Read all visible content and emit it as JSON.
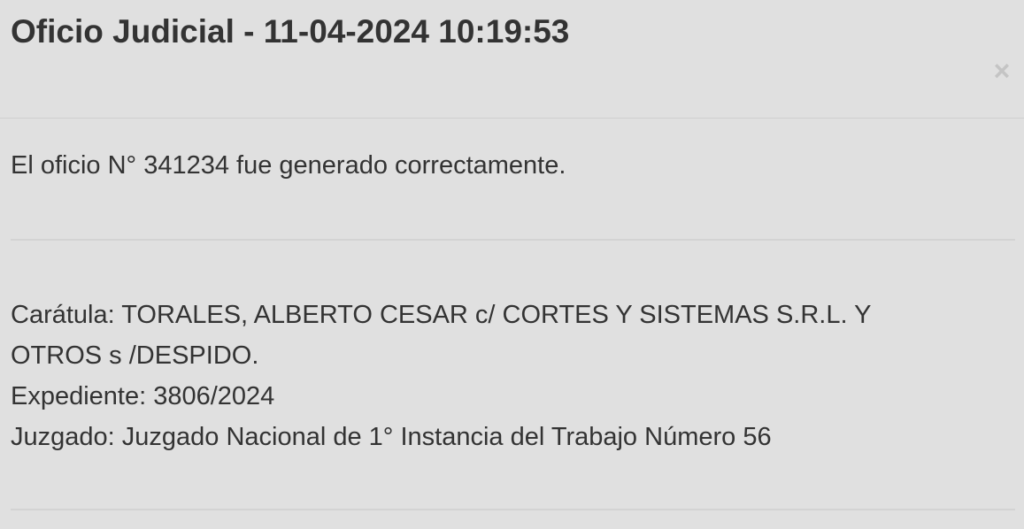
{
  "dialog": {
    "title": "Oficio Judicial - 11-04-2024 10:19:53",
    "close_icon": "close-icon",
    "close_glyph": "×"
  },
  "body": {
    "message": "El oficio N° 341234 fue generado correctamente.",
    "caratula_line1": "Carátula: TORALES, ALBERTO CESAR c/ CORTES Y SISTEMAS S.R.L. Y",
    "caratula_line2": "OTROS s /DESPIDO.",
    "expediente": "Expediente: 3806/2024",
    "juzgado": "Juzgado: Juzgado Nacional de 1° Instancia del Trabajo Número 56"
  },
  "colors": {
    "background": "#e0e0e0",
    "text": "#333333",
    "close_icon": "#c4c4c4",
    "divider": "#d3d3d3"
  }
}
